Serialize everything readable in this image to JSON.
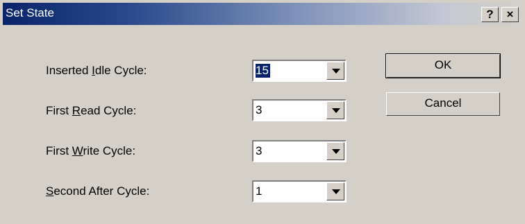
{
  "window": {
    "title": "Set State",
    "help_button": "?",
    "close_button": "×"
  },
  "fields": [
    {
      "label_pre": "Inserted ",
      "label_key": "I",
      "label_post": "dle Cycle:",
      "value": "15"
    },
    {
      "label_pre": "First ",
      "label_key": "R",
      "label_post": "ead Cycle:",
      "value": "3"
    },
    {
      "label_pre": "First ",
      "label_key": "W",
      "label_post": "rite Cycle:",
      "value": "3"
    },
    {
      "label_pre": "",
      "label_key": "S",
      "label_post": "econd After Cycle:",
      "value": "1"
    }
  ],
  "buttons": {
    "ok": "OK",
    "cancel": "Cancel"
  }
}
